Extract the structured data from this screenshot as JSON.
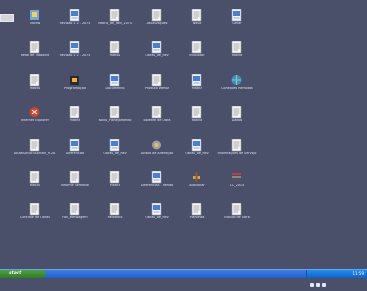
{
  "desktop": {
    "icons": [
      {
        "label": "Vdraw",
        "type": "app-blue"
      },
      {
        "label": "Rede de Trabalho",
        "type": "doc"
      },
      {
        "label": "Ratios",
        "type": "doc"
      },
      {
        "label": "Internet Explorer",
        "type": "app-red"
      },
      {
        "label": "AtulaSonucuSonlari_9.2010",
        "type": "doc"
      },
      {
        "label": "Ratios",
        "type": "doc-alt"
      },
      {
        "label": "Controle de Obras",
        "type": "doc"
      },
      {
        "label": "Revisão 1 2 - 2074",
        "type": "doc-blue"
      },
      {
        "label": "Revisão 2 2 - 2074",
        "type": "doc-blue"
      },
      {
        "label": "Programação",
        "type": "app-media"
      },
      {
        "label": "Matriz",
        "type": "doc"
      },
      {
        "label": "Diferencias",
        "type": "doc-blue"
      },
      {
        "label": "Informe Semanal",
        "type": "doc"
      },
      {
        "label": "Fax_Mensagem",
        "type": "doc"
      },
      {
        "label": "Matriz_de_Rev_2074",
        "type": "doc"
      },
      {
        "label": "Ratios",
        "type": "doc"
      },
      {
        "label": "Documento",
        "type": "doc-blue"
      },
      {
        "label": "Novo_Planejamento",
        "type": "doc"
      },
      {
        "label": "Obras_de_Rev",
        "type": "doc-blue"
      },
      {
        "label": "Matriz",
        "type": "doc"
      },
      {
        "label": "Relatorio",
        "type": "doc"
      },
      {
        "label": "Atualizações",
        "type": "doc"
      },
      {
        "label": "Obras_de_Rev",
        "type": "doc-blue"
      },
      {
        "label": "Produto Wentz",
        "type": "doc"
      },
      {
        "label": "Boletim de Obra",
        "type": "doc"
      },
      {
        "label": "Avisos de Alteração",
        "type": "app-gear"
      },
      {
        "label": "Diferencias - Renda",
        "type": "doc-blue"
      },
      {
        "label": "Obras_de_Rev",
        "type": "doc-blue"
      },
      {
        "label": "Novo",
        "type": "doc"
      },
      {
        "label": "Indicador",
        "type": "doc"
      },
      {
        "label": "Matriz",
        "type": "doc-blue"
      },
      {
        "label": "Rotina",
        "type": "doc"
      },
      {
        "label": "Obras_de_Rev",
        "type": "doc-blue"
      },
      {
        "label": "Adicionar",
        "type": "app-tools"
      },
      {
        "label": "Planilhas",
        "type": "doc"
      },
      {
        "label": "Gerar",
        "type": "doc-blue"
      },
      {
        "label": "Rotina",
        "type": "doc"
      },
      {
        "label": "Conexões Remotas",
        "type": "app-globe"
      },
      {
        "label": "Dados",
        "type": "doc"
      },
      {
        "label": "Informações de Serviço",
        "type": "doc"
      },
      {
        "label": "LC_2014",
        "type": "app-stack"
      },
      {
        "label": "Estudo de Obra",
        "type": "doc"
      }
    ]
  },
  "taskbar": {
    "start_label": "start",
    "clock": "11:59"
  },
  "colors": {
    "desktop": "#4a506a",
    "taskbar": "#245edb",
    "start": "#3c8f33"
  }
}
